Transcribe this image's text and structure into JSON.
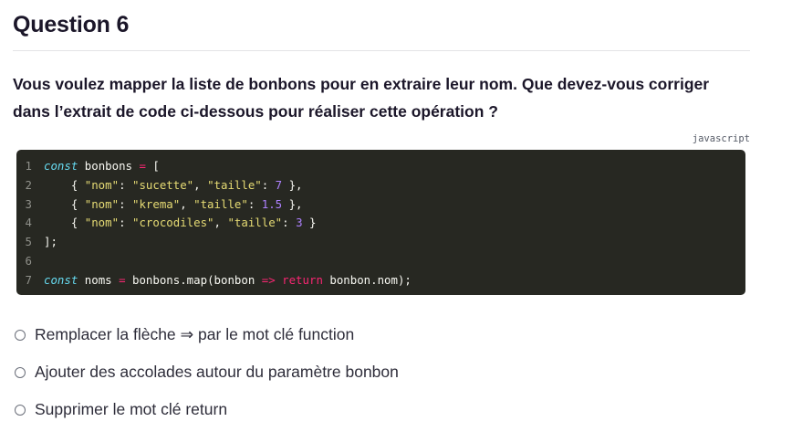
{
  "question": {
    "title": "Question 6",
    "prompt": "Vous voulez mapper la liste de bonbons pour en extraire leur nom. Que devez-vous corriger dans l’extrait de code ci-dessous pour réaliser cette opération ?"
  },
  "code_block": {
    "language": "javascript",
    "lines": [
      {
        "n": "1",
        "tokens": [
          [
            "kw",
            "const"
          ],
          [
            "p",
            " bonbons "
          ],
          [
            "op",
            "="
          ],
          [
            "p",
            " ["
          ]
        ]
      },
      {
        "n": "2",
        "tokens": [
          [
            "p",
            "    { "
          ],
          [
            "str",
            "\"nom\""
          ],
          [
            "p",
            ": "
          ],
          [
            "str",
            "\"sucette\""
          ],
          [
            "p",
            ", "
          ],
          [
            "str",
            "\"taille\""
          ],
          [
            "p",
            ": "
          ],
          [
            "num",
            "7"
          ],
          [
            "p",
            " },"
          ]
        ]
      },
      {
        "n": "3",
        "tokens": [
          [
            "p",
            "    { "
          ],
          [
            "str",
            "\"nom\""
          ],
          [
            "p",
            ": "
          ],
          [
            "str",
            "\"krema\""
          ],
          [
            "p",
            ", "
          ],
          [
            "str",
            "\"taille\""
          ],
          [
            "p",
            ": "
          ],
          [
            "num",
            "1.5"
          ],
          [
            "p",
            " },"
          ]
        ]
      },
      {
        "n": "4",
        "tokens": [
          [
            "p",
            "    { "
          ],
          [
            "str",
            "\"nom\""
          ],
          [
            "p",
            ": "
          ],
          [
            "str",
            "\"crocodiles\""
          ],
          [
            "p",
            ", "
          ],
          [
            "str",
            "\"taille\""
          ],
          [
            "p",
            ": "
          ],
          [
            "num",
            "3"
          ],
          [
            "p",
            " }"
          ]
        ]
      },
      {
        "n": "5",
        "tokens": [
          [
            "p",
            "];"
          ]
        ]
      },
      {
        "n": "6",
        "tokens": []
      },
      {
        "n": "7",
        "tokens": [
          [
            "kw",
            "const"
          ],
          [
            "p",
            " noms "
          ],
          [
            "op",
            "="
          ],
          [
            "p",
            " bonbons.map(bonbon "
          ],
          [
            "op",
            "=>"
          ],
          [
            "p",
            " "
          ],
          [
            "op",
            "return"
          ],
          [
            "p",
            " bonbon.nom);"
          ]
        ]
      }
    ]
  },
  "options": [
    {
      "label": "Remplacer la flèche ⇒ par le mot clé function"
    },
    {
      "label": "Ajouter des accolades autour du paramètre bonbon"
    },
    {
      "label": "Supprimer le mot clé return"
    }
  ]
}
